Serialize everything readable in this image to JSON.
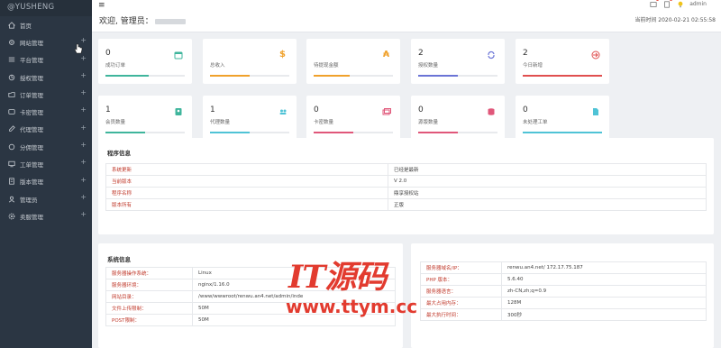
{
  "brand": "@YUSHENG",
  "sidebar": {
    "items": [
      {
        "label": "首页",
        "icon": "home-icon"
      },
      {
        "label": "网站管理",
        "icon": "settings-icon"
      },
      {
        "label": "平台管理",
        "icon": "list-icon"
      },
      {
        "label": "授权管理",
        "icon": "key-icon"
      },
      {
        "label": "订单管理",
        "icon": "folder-icon"
      },
      {
        "label": "卡密管理",
        "icon": "card-icon"
      },
      {
        "label": "代理管理",
        "icon": "pencil-icon"
      },
      {
        "label": "分佣管理",
        "icon": "coin-icon"
      },
      {
        "label": "工单管理",
        "icon": "screen-icon"
      },
      {
        "label": "版本管理",
        "icon": "document-icon"
      },
      {
        "label": "管理员",
        "icon": "user-icon"
      },
      {
        "label": "卖服管理",
        "icon": "gear-icon"
      }
    ]
  },
  "topbar": {
    "welcome": "欢迎, 管理员：",
    "time": "当前时间 2020-02-21 02:55:58",
    "user_label": "admin"
  },
  "cards": [
    {
      "value": "0",
      "label": "成功订单",
      "icon": "calendar-icon",
      "color": "#3fb59c",
      "fill": 0.55
    },
    {
      "value": "",
      "label": "总收入",
      "icon": "dollar-icon",
      "color": "#f0a12b",
      "fill": 0.5
    },
    {
      "value": "",
      "label": "待提现金额",
      "icon": "currency-icon",
      "color": "#f0a12b",
      "fill": 0.45
    },
    {
      "value": "2",
      "label": "授权数量",
      "icon": "refresh-icon",
      "color": "#6a74d6",
      "fill": 0.5
    },
    {
      "value": "2",
      "label": "今日新增",
      "icon": "login-icon",
      "color": "#e04f4f",
      "fill": 1.0
    },
    {
      "value": "1",
      "label": "会员数量",
      "icon": "contact-icon",
      "color": "#3fb59c",
      "fill": 0.5
    },
    {
      "value": "1",
      "label": "代理数量",
      "icon": "users-icon",
      "color": "#4fc3d6",
      "fill": 0.5
    },
    {
      "value": "0",
      "label": "卡密数量",
      "icon": "cards-icon",
      "color": "#e0577a",
      "fill": 0.5
    },
    {
      "value": "0",
      "label": "源版数量",
      "icon": "database-icon",
      "color": "#e0577a",
      "fill": 0.5
    },
    {
      "value": "0",
      "label": "未处理工单",
      "icon": "file-icon",
      "color": "#4fc3d6",
      "fill": 1.0
    }
  ],
  "program": {
    "title": "程序信息",
    "rows": [
      {
        "k": "系统更新",
        "v": "已经是最新"
      },
      {
        "k": "当前版本",
        "v": "V 2.0"
      },
      {
        "k": "程序名称",
        "v": "鼎享授权站"
      },
      {
        "k": "版本所有",
        "v": "正版"
      }
    ]
  },
  "system": {
    "title": "系统信息",
    "rows": [
      {
        "k": "服务器操作系统：",
        "v": "Linux"
      },
      {
        "k": "服务器环境：",
        "v": "nginx/1.16.0"
      },
      {
        "k": "网站目录：",
        "v": "/www/wwwroot/renwu.an4.net/admin/inde"
      },
      {
        "k": "文件上传限制：",
        "v": "50M"
      },
      {
        "k": "POST限制：",
        "v": "50M"
      }
    ]
  },
  "server": {
    "rows": [
      {
        "k": "服务器域名/IP：",
        "v": "renwu.an4.net/ 172.17.75.187"
      },
      {
        "k": "PHP 版本：",
        "v": "5.6.40"
      },
      {
        "k": "服务器语言：",
        "v": "zh-CN,zh;q=0.9"
      },
      {
        "k": "最大占用内存：",
        "v": "128M"
      },
      {
        "k": "最大执行时间：",
        "v": "300秒"
      }
    ]
  },
  "watermark": {
    "big": "IT源码",
    "url": "www.ttym.cc"
  }
}
